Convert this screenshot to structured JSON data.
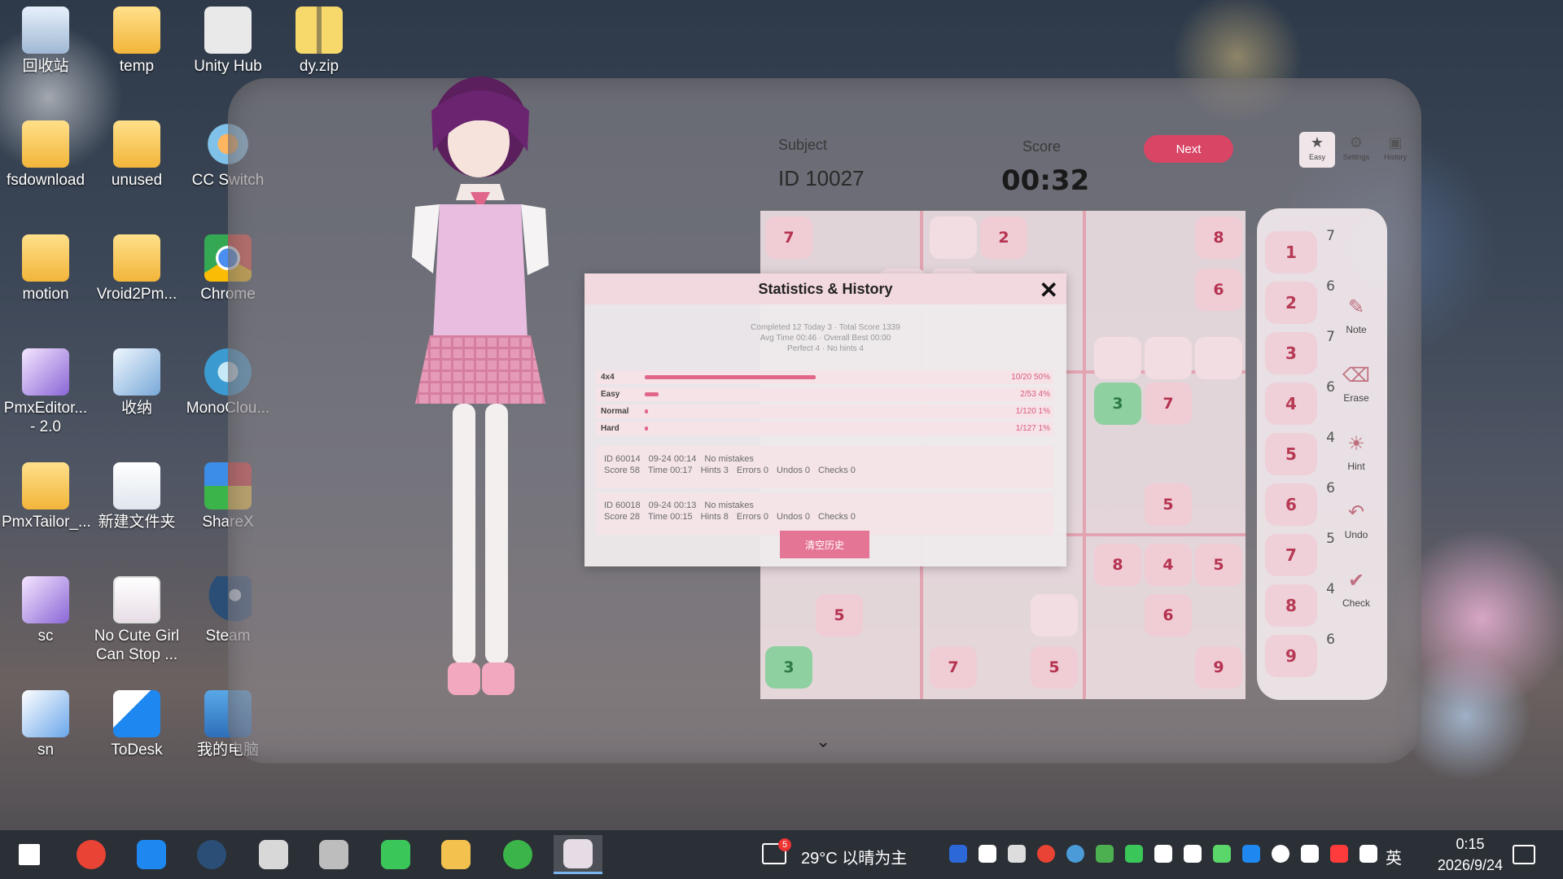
{
  "desktop_icons": [
    {
      "label": "回收站",
      "icon": "recycle-bin-icon"
    },
    {
      "label": "temp",
      "icon": "folder-icon"
    },
    {
      "label": "Unity Hub",
      "icon": "unity-hub-icon"
    },
    {
      "label": "dy.zip",
      "icon": "zip-icon"
    },
    {
      "label": "fsdownload",
      "icon": "folder-icon"
    },
    {
      "label": "unused",
      "icon": "folder-icon"
    },
    {
      "label": "CC Switch",
      "icon": "cc-switch-icon"
    },
    {
      "label": "motion",
      "icon": "folder-icon"
    },
    {
      "label": "Vroid2Pm...",
      "icon": "folder-icon"
    },
    {
      "label": "Chrome",
      "icon": "chrome-icon"
    },
    {
      "label": "PmxEditor... - 2.0",
      "icon": "folder-icon"
    },
    {
      "label": "收纳",
      "icon": "folder-icon"
    },
    {
      "label": "MonoClou...",
      "icon": "monocloud-icon"
    },
    {
      "label": "PmxTailor_...",
      "icon": "folder-icon"
    },
    {
      "label": "新建文件夹",
      "icon": "folder-icon"
    },
    {
      "label": "ShareX",
      "icon": "sharex-icon"
    },
    {
      "label": "sc",
      "icon": "folder-icon"
    },
    {
      "label": "No Cute Girl Can Stop ...",
      "icon": "game-icon"
    },
    {
      "label": "Steam",
      "icon": "steam-icon"
    },
    {
      "label": "sn",
      "icon": "sn-icon"
    },
    {
      "label": "ToDesk",
      "icon": "todesk-icon"
    },
    {
      "label": "我的电脑",
      "icon": "computer-icon"
    }
  ],
  "game": {
    "subject_label": "Subject",
    "puzzle_id": "ID 10027",
    "score_label": "Score",
    "timer": "00:32",
    "next_label": "Next",
    "top_tools": [
      {
        "label": "Easy",
        "icon": "star-icon"
      },
      {
        "label": "Settings",
        "icon": "gear-icon"
      },
      {
        "label": "History",
        "icon": "history-icon"
      }
    ],
    "board_cells": [
      {
        "value": "7",
        "style": "normal"
      },
      {
        "value": "2",
        "style": "normal"
      },
      {
        "value": "8",
        "style": "normal"
      },
      {
        "value": "6",
        "style": "normal"
      },
      {
        "value": "3",
        "style": "green"
      },
      {
        "value": "7",
        "style": "normal"
      },
      {
        "value": "5",
        "style": "normal"
      },
      {
        "value": "8",
        "style": "normal"
      },
      {
        "value": "4",
        "style": "normal"
      },
      {
        "value": "5",
        "style": "normal"
      },
      {
        "value": "5",
        "style": "normal"
      },
      {
        "value": "6",
        "style": "normal"
      },
      {
        "value": "3",
        "style": "green"
      },
      {
        "value": "7",
        "style": "normal"
      },
      {
        "value": "5",
        "style": "normal"
      },
      {
        "value": "9",
        "style": "normal"
      }
    ],
    "number_pad": [
      {
        "digit": "1",
        "count": "7"
      },
      {
        "digit": "2",
        "count": "6"
      },
      {
        "digit": "3",
        "count": "7"
      },
      {
        "digit": "4",
        "count": "6"
      },
      {
        "digit": "5",
        "count": "4"
      },
      {
        "digit": "6",
        "count": "6"
      },
      {
        "digit": "7",
        "count": "5"
      },
      {
        "digit": "8",
        "count": "4"
      },
      {
        "digit": "9",
        "count": "6"
      }
    ],
    "tools": [
      {
        "label": "Note",
        "icon": "pencil-icon"
      },
      {
        "label": "Erase",
        "icon": "eraser-icon"
      },
      {
        "label": "Hint",
        "icon": "lightbulb-icon"
      },
      {
        "label": "Undo",
        "icon": "undo-icon"
      },
      {
        "label": "Check",
        "icon": "check-icon"
      }
    ]
  },
  "modal": {
    "title": "Statistics & History",
    "summary_line1": "Completed 12 Today 3 · Total Score 1339",
    "summary_line2": "Avg Time 00:46 · Overall Best 00:00",
    "summary_line3": "Perfect 4 · No hints 4",
    "difficulties": [
      {
        "label": "4x4",
        "stat": "10/20 50%",
        "fraction": 0.5
      },
      {
        "label": "Easy",
        "stat": "2/53 4%",
        "fraction": 0.04
      },
      {
        "label": "Normal",
        "stat": "1/120 1%",
        "fraction": 0.01
      },
      {
        "label": "Hard",
        "stat": "1/127 1%",
        "fraction": 0.01
      }
    ],
    "history": [
      {
        "id": "ID 60014",
        "date": "09-24 00:14",
        "result": "No mistakes",
        "score": "Score 58",
        "time": "Time 00:17",
        "hints": "Hints 3",
        "errors": "Errors 0",
        "undos": "Undos 0",
        "checks": "Checks 0"
      },
      {
        "id": "ID 60018",
        "date": "09-24 00:13",
        "result": "No mistakes",
        "score": "Score 28",
        "time": "Time 00:15",
        "hints": "Hints 8",
        "errors": "Errors 0",
        "undos": "Undos 0",
        "checks": "Checks 0"
      }
    ],
    "clear_label": "清空历史"
  },
  "taskbar": {
    "apps": [
      "windows-start-icon",
      "chrome-icon",
      "todesk-icon",
      "steam-icon",
      "unity-icon",
      "unity-hub-icon",
      "wechat-icon",
      "file-explorer-icon",
      "sharex-icon",
      "game-icon"
    ],
    "weather_badge": "5",
    "weather": "29°C 以晴为主",
    "ime": "英",
    "time": "0:15",
    "date": "2026/9/24"
  }
}
